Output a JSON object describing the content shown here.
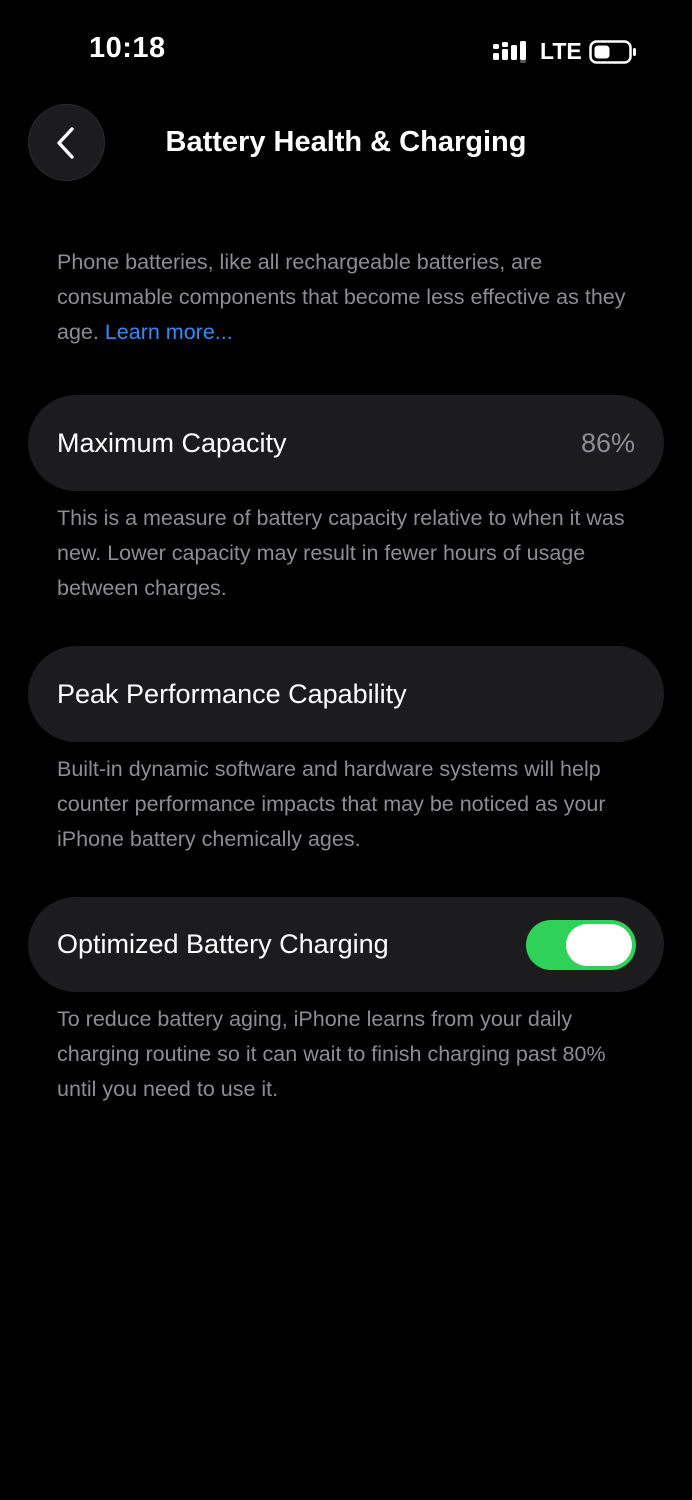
{
  "status_bar": {
    "time": "10:18",
    "network": "LTE",
    "signal_icon": "signal-bars-icon",
    "battery_icon": "battery-icon"
  },
  "nav": {
    "title": "Battery Health & Charging",
    "back_icon": "chevron-left-icon"
  },
  "intro": {
    "text": "Phone batteries, like all rechargeable batteries, are consumable components that become less effective as they age.",
    "link": "Learn more..."
  },
  "maximum_capacity": {
    "label": "Maximum Capacity",
    "value": "86%",
    "description": "This is a measure of battery capacity relative to when it was new. Lower capacity may result in fewer hours of usage between charges."
  },
  "peak_performance": {
    "label": "Peak Performance Capability",
    "description": "Built-in dynamic software and hardware systems will help counter performance impacts that may be noticed as your iPhone battery chemically ages."
  },
  "optimized_charging": {
    "label": "Optimized Battery Charging",
    "enabled": true,
    "description": "To reduce battery aging, iPhone learns from your daily charging routine so it can wait to finish charging past 80% until you need to use it."
  },
  "colors": {
    "background": "#000000",
    "card": "#1c1c1e",
    "secondary_text": "#8d8d93",
    "link": "#2f8cff",
    "toggle_on": "#30d158"
  }
}
